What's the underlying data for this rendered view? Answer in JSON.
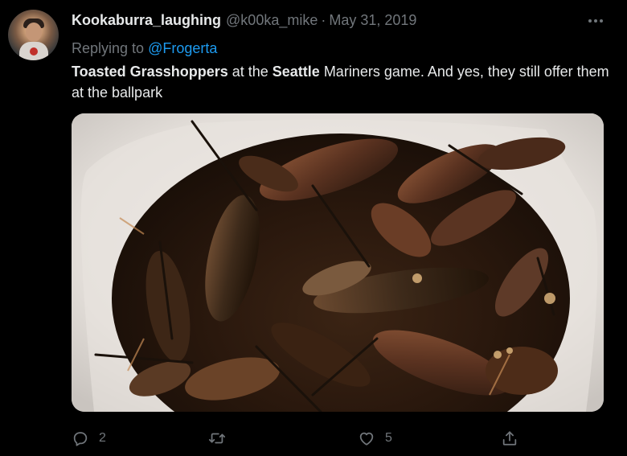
{
  "tweet": {
    "display_name": "Kookaburra_laughing",
    "handle": "@k00ka_mike",
    "separator": "·",
    "date": "May 31, 2019",
    "reply_prefix": "Replying to",
    "reply_to": "@Frogerta",
    "text_parts": {
      "p1": "Toasted Grasshoppers",
      "p2": " at the ",
      "p3": "Seattle",
      "p4": " Mariners game. And yes, they still offer them at the ballpark"
    }
  },
  "actions": {
    "reply_icon": "reply-icon",
    "reply_count": "2",
    "retweet_icon": "retweet-icon",
    "retweet_count": "",
    "like_icon": "heart-icon",
    "like_count": "5",
    "share_icon": "share-icon"
  },
  "colors": {
    "background": "#000000",
    "text": "#e7e9ea",
    "secondary": "#71767b",
    "link": "#1d9bf0"
  }
}
